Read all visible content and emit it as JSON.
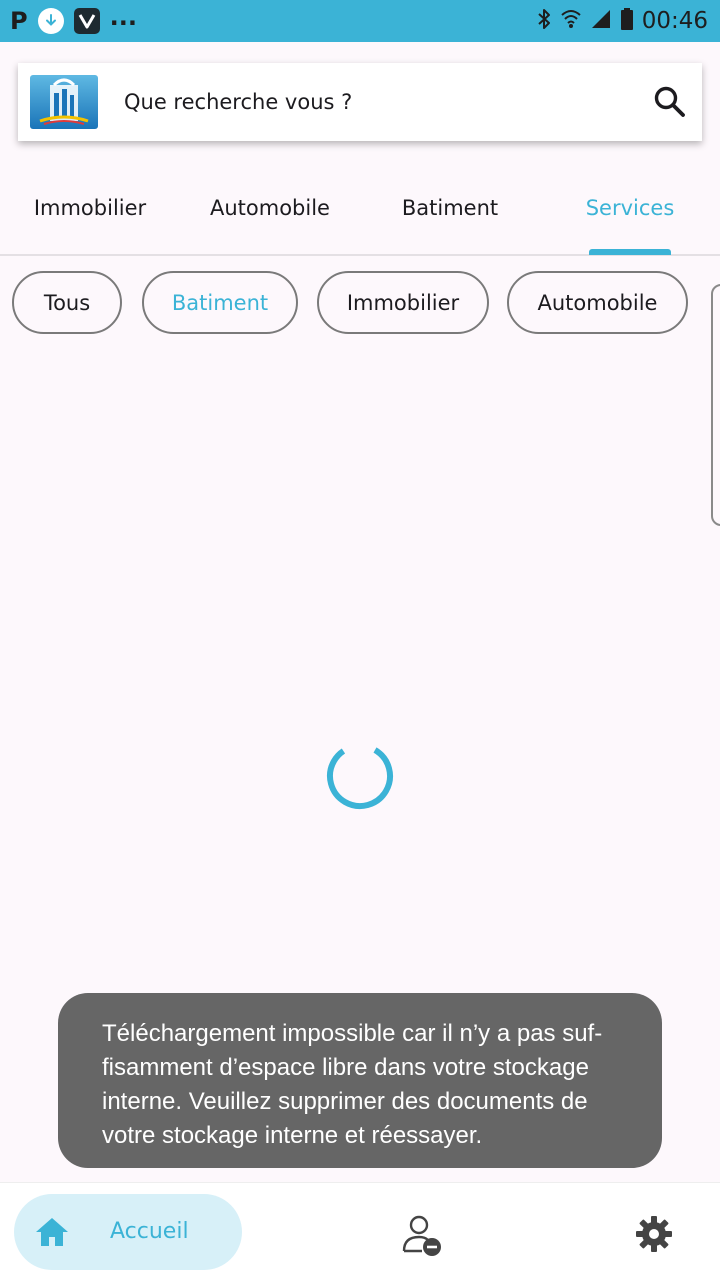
{
  "status_bar": {
    "left_letter": "P",
    "more": "...",
    "time": "00:46",
    "icons": [
      "p-icon",
      "download-icon",
      "v-app-icon",
      "bluetooth-icon",
      "wifi-icon",
      "signal-icon",
      "battery-icon"
    ]
  },
  "search": {
    "placeholder": "Que recherche vous ?"
  },
  "tabs": [
    {
      "label": "Immobilier",
      "active": false
    },
    {
      "label": "Automobile",
      "active": false
    },
    {
      "label": "Batiment",
      "active": false
    },
    {
      "label": "Services",
      "active": true
    }
  ],
  "chips": [
    {
      "label": "Tous",
      "selected": false
    },
    {
      "label": "Batiment",
      "selected": true
    },
    {
      "label": "Immobilier",
      "selected": false
    },
    {
      "label": "Automobile",
      "selected": false
    }
  ],
  "toast": {
    "lines": [
      "Téléchargement impossible car il n’y a pas suf-",
      "fisamment d’espace libre dans votre stockage",
      "interne. Veuillez supprimer des documents de",
      "votre stockage interne et réessayer."
    ]
  },
  "bottom_nav": {
    "home_label": "Accueil"
  },
  "colors": {
    "accent": "#3bb3d6",
    "status_bar": "#3bb3d6",
    "toast_bg": "#666666",
    "page_bg": "#fdf8fc"
  }
}
